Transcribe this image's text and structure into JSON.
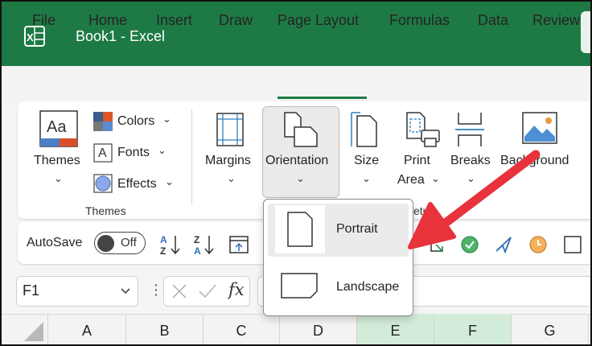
{
  "window": {
    "title": "Book1  -  Excel"
  },
  "menu": {
    "tabs": [
      "File",
      "Home",
      "Insert",
      "Draw",
      "Page Layout",
      "Formulas",
      "Data",
      "Review"
    ],
    "active": "Page Layout"
  },
  "ribbon": {
    "themes": {
      "button_label": "Themes",
      "colors_label": "Colors",
      "fonts_label": "Fonts",
      "effects_label": "Effects",
      "group_label": "Themes",
      "fonts_glyph": "A",
      "theme_glyph": "Aa"
    },
    "page_setup": {
      "margins_label": "Margins",
      "orientation_label": "Orientation",
      "size_label": "Size",
      "print_area_line1": "Print",
      "print_area_line2": "Area",
      "breaks_label": "Breaks",
      "background_label": "Background",
      "group_label_partial": "etup"
    }
  },
  "quick_access": {
    "autosave_label": "AutoSave",
    "autosave_state": "Off"
  },
  "formula_bar": {
    "name_box": "F1",
    "fx_label": "fx"
  },
  "columns": [
    "A",
    "B",
    "C",
    "D",
    "E",
    "F",
    "G"
  ],
  "selected_columns": [
    "E",
    "F"
  ],
  "orientation_dropdown": {
    "items": [
      {
        "label": "Portrait",
        "hovered": true
      },
      {
        "label": "Landscape",
        "hovered": false
      }
    ]
  },
  "colors": {
    "excel_green": "#1e7a45",
    "arrow_red": "#e8323c",
    "selected_col": "#d3ecd9"
  }
}
